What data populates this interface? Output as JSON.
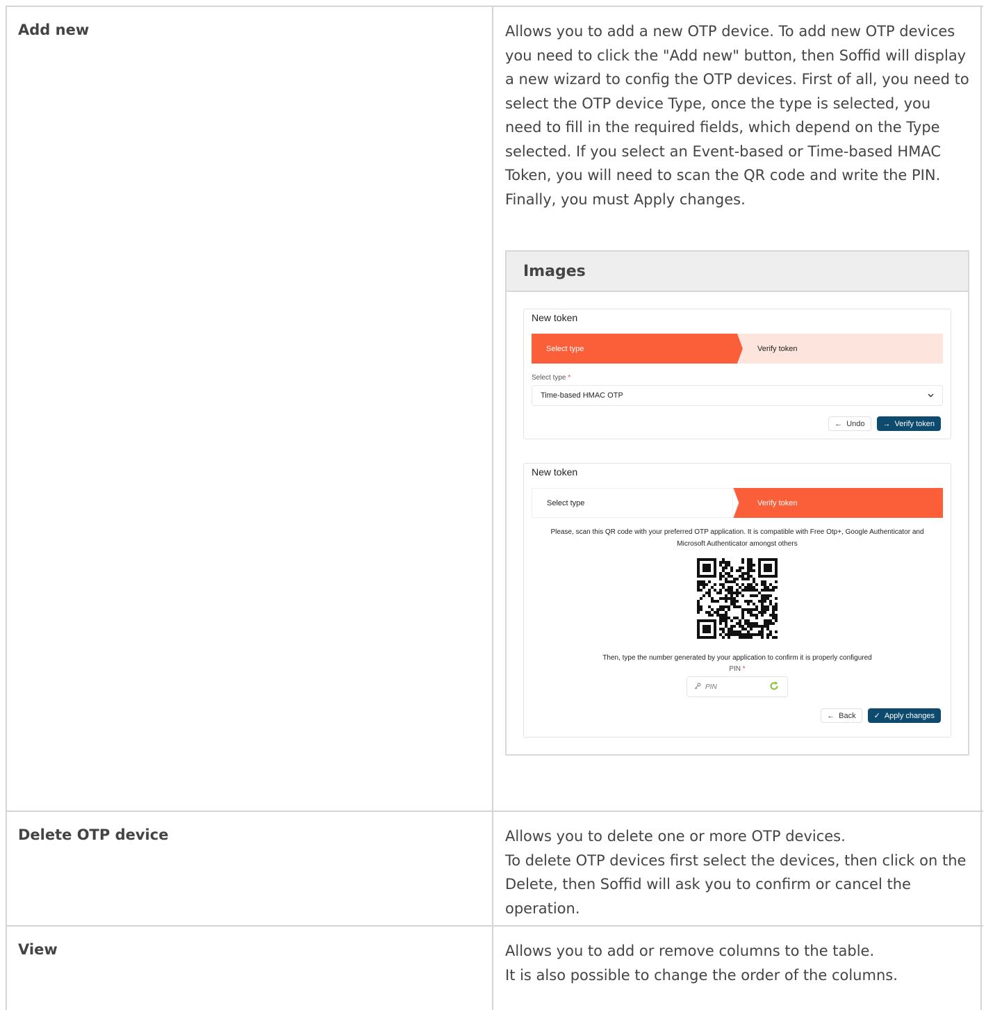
{
  "rows": [
    {
      "term": "Add new",
      "description": [
        "Allows you to add a new OTP device. To add new OTP devices you need to click the \"Add new\" button, then Soffid will display a new wizard to config the OTP devices. First of all, you need to select the OTP device Type, once the type is selected, you need to fill in the required fields, which depend on the Type selected. If you select an Event-based or Time-based HMAC Token, you will need to scan the QR code and write the PIN. Finally, you must Apply changes."
      ]
    },
    {
      "term": "Delete OTP device",
      "description": [
        "Allows you to delete one or more OTP devices.",
        "To delete OTP devices first select the devices, then click on the Delete, then Soffid will ask you to confirm or cancel the operation."
      ]
    },
    {
      "term": "View",
      "description": [
        "Allows you to add or remove columns to the table.",
        "It is also possible to change the order of the columns."
      ]
    }
  ],
  "images_panel": {
    "title": "Images",
    "screenshot1": {
      "title": "New token",
      "step1": "Select type",
      "step2": "Verify token",
      "field_label": "Select type",
      "required_mark": "*",
      "select_value": "Time-based HMAC OTP",
      "undo_button": "Undo",
      "verify_button": "Verify token"
    },
    "screenshot2": {
      "title": "New token",
      "step1": "Select type",
      "step2": "Verify token",
      "info_line1": "Please, scan this QR code with your preferred OTP application. It is compatible with Free Otp+, Google Authenticator and",
      "info_line2": "Microsoft Authenticator amongst others",
      "after_qr": "Then, type the number generated by your application to confirm it is properly configured",
      "pin_label": "PIN",
      "required_mark": "*",
      "pin_placeholder": "PIN",
      "back_button": "Back",
      "apply_button": "Apply changes"
    }
  },
  "colors": {
    "active_step": "#fa5f3a",
    "inactive_step": "#fde4dd",
    "primary_button": "#0e4a6e",
    "refresh_icon": "#8cc63f"
  },
  "icons": [
    "chevron-down-icon",
    "arrow-left-icon",
    "arrow-right-icon",
    "check-icon",
    "key-icon",
    "refresh-icon",
    "qr-code"
  ]
}
